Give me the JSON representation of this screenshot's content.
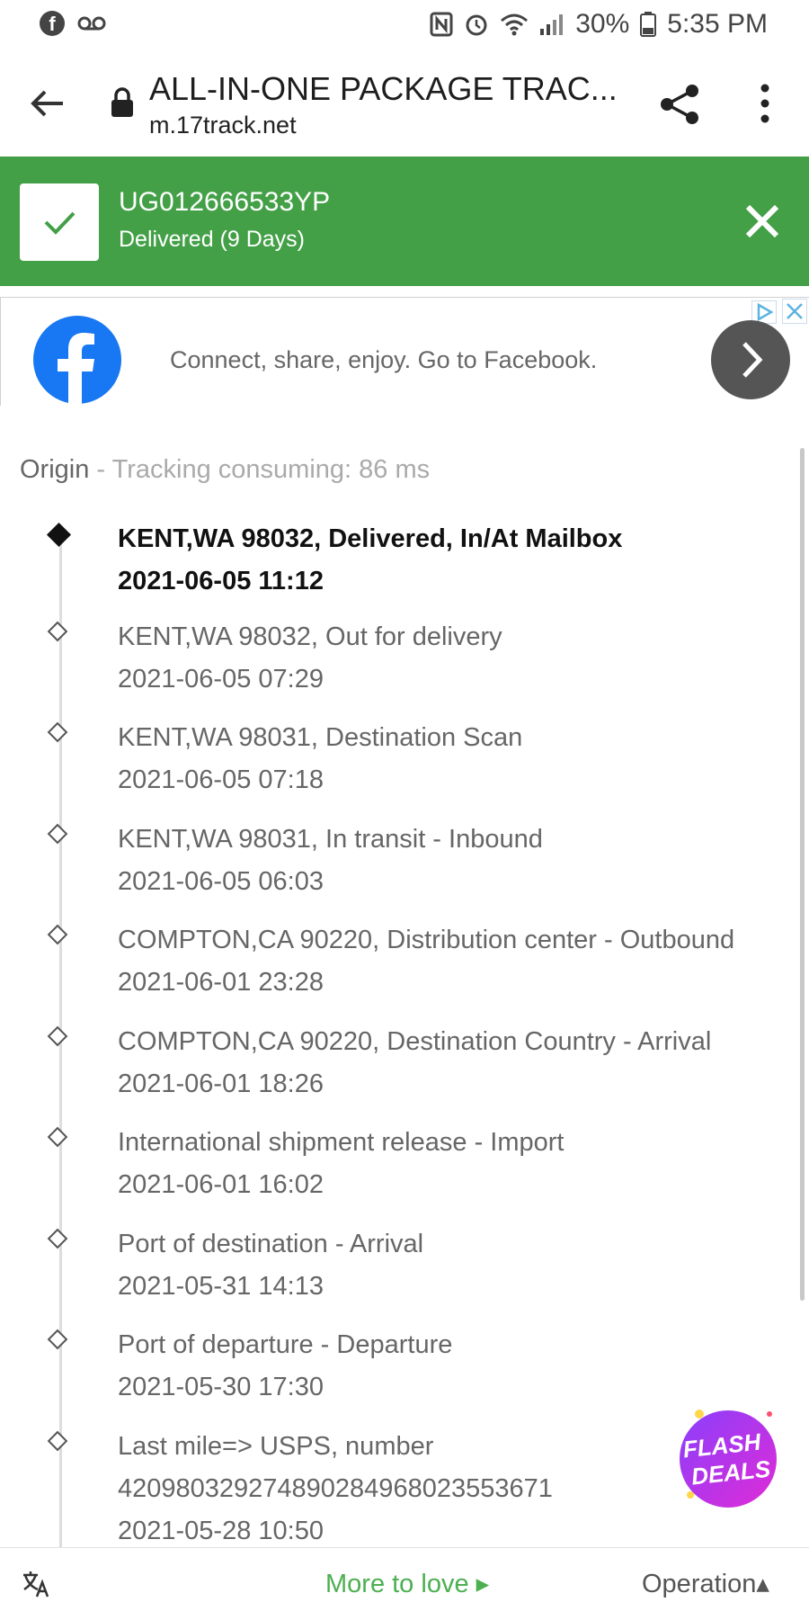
{
  "status_bar": {
    "battery": "30%",
    "time": "5:35 PM",
    "icons": [
      "facebook-icon",
      "voicemail-icon",
      "nfc-icon",
      "alarm-icon",
      "wifi-icon",
      "signal-icon",
      "battery-icon"
    ]
  },
  "browser": {
    "title": "ALL-IN-ONE PACKAGE TRAC...",
    "url": "m.17track.net"
  },
  "banner": {
    "tracking_number": "UG012666533YP",
    "status": "Delivered (9 Days)",
    "color": "#43a047"
  },
  "ad": {
    "text": "Connect, share, enjoy. Go to Facebook."
  },
  "origin": {
    "label": "Origin",
    "separator": " - ",
    "consuming": "Tracking consuming: 86 ms"
  },
  "events": [
    {
      "desc": "KENT,WA 98032, Delivered, In/At Mailbox",
      "time": "2021-06-05 11:12"
    },
    {
      "desc": "KENT,WA 98032, Out for delivery",
      "time": "2021-06-05 07:29"
    },
    {
      "desc": "KENT,WA 98031, Destination Scan",
      "time": "2021-06-05 07:18"
    },
    {
      "desc": "KENT,WA 98031, In transit - Inbound",
      "time": "2021-06-05 06:03"
    },
    {
      "desc": "COMPTON,CA 90220, Distribution center - Outbound",
      "time": "2021-06-01 23:28"
    },
    {
      "desc": "COMPTON,CA 90220, Destination Country - Arrival",
      "time": "2021-06-01 18:26"
    },
    {
      "desc": "International shipment release - Import",
      "time": "2021-06-01 16:02"
    },
    {
      "desc": "Port of destination - Arrival",
      "time": "2021-05-31 14:13"
    },
    {
      "desc": "Port of departure - Departure",
      "time": "2021-05-30 17:30"
    },
    {
      "desc": "Last mile=> USPS, number",
      "extra": "420980329274890284968023553671",
      "time": "2021-05-28 10:50"
    }
  ],
  "flash_deals": {
    "line1": "FLASH",
    "line2": "DEALS"
  },
  "bottom": {
    "more_to_love": "More to love ▸",
    "operation": "Operation▴"
  }
}
